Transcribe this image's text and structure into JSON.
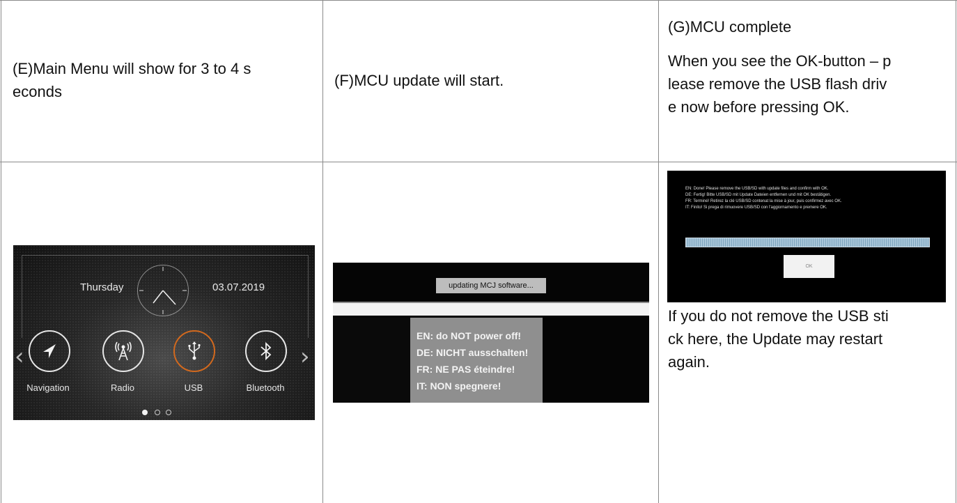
{
  "columns": [
    {
      "header": [
        "(E)Main Menu will show for 3 to 4 s",
        "econds"
      ],
      "screen": {
        "day": "Thursday",
        "date": "03.07.2019",
        "menu_items": [
          "Navigation",
          "Radio",
          "USB",
          "Bluetooth"
        ],
        "active_item": "USB",
        "page_count": 3,
        "current_page": 1
      }
    },
    {
      "header": [
        "(F)MCU update will start."
      ],
      "screen": {
        "title": "updating MCJ software...",
        "warnings": [
          "EN: do NOT power off!",
          "DE: NICHT ausschalten!",
          "FR: NE PAS éteindre!",
          "IT: NON spegnere!"
        ]
      }
    },
    {
      "header": [
        "(G)MCU complete"
      ],
      "header_body": [
        "When you see the OK-button – p",
        "lease remove the USB flash driv",
        "e now before pressing OK."
      ],
      "screen": {
        "messages": [
          "EN: Done! Please remove the USB/SD with update files and confirm with OK.",
          "DE: Fertig! Bitte USB/SD mit Update Dateien entfernen und mit OK bestätigen.",
          "FR: Terminé! Retirez la clé USB/SD contenat la mise à jour, puis confirmez avec OK.",
          "IT: Finito! Si prega di rimuovere USB/SD con l'aggiornamento e premere OK."
        ],
        "ok_label": "OK",
        "progress": 1.0
      },
      "note": [
        "If you do not remove the USB sti",
        "ck here, the Update may restart",
        "again."
      ]
    }
  ],
  "colors": {
    "border": "#8a8a8a",
    "accent_usb": "#d2691e"
  }
}
